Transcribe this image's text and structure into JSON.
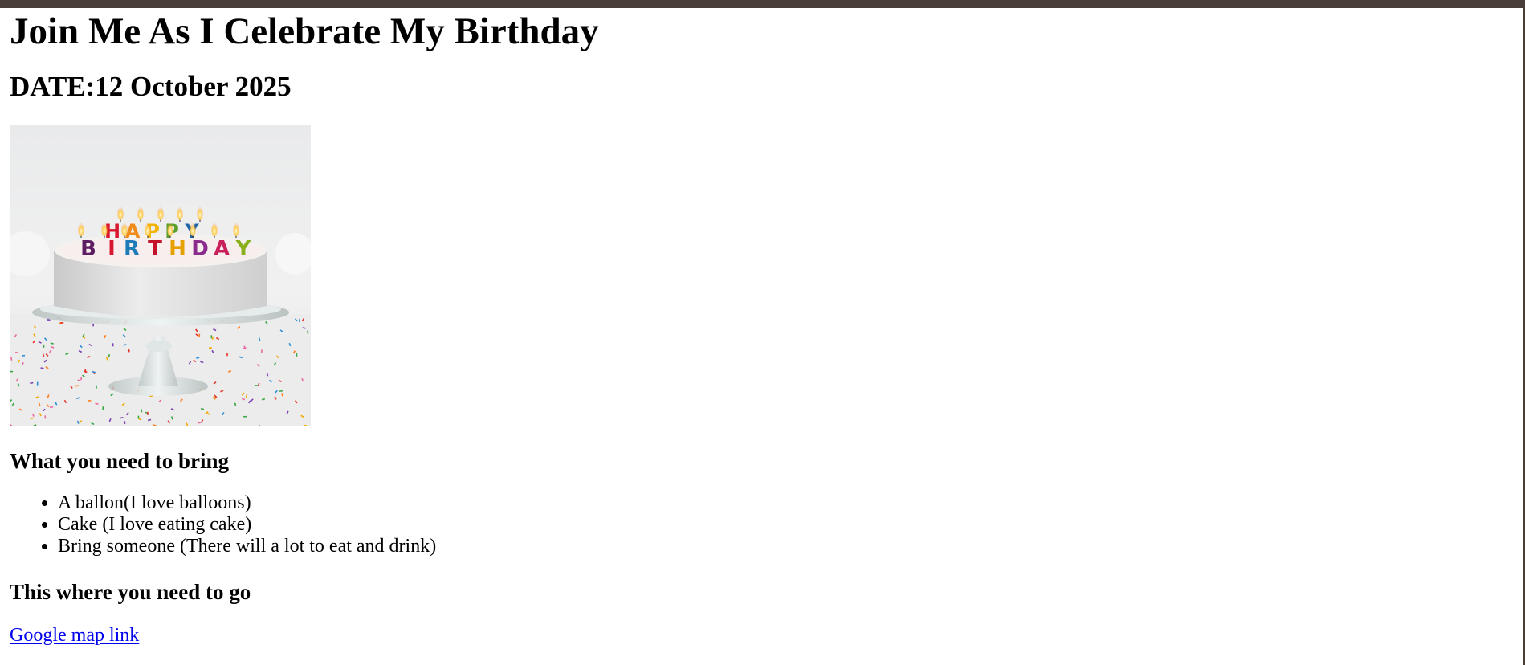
{
  "heading": "Join Me As I Celebrate My Birthday",
  "date_heading": "DATE:12 October 2025",
  "image": {
    "alt": "Birthday cake",
    "candle_letters_top": [
      "H",
      "A",
      "P",
      "P",
      "Y"
    ],
    "candle_letters_bottom": [
      "B",
      "I",
      "R",
      "T",
      "H",
      "D",
      "A",
      "Y"
    ],
    "colors_top": [
      "#d8182e",
      "#f08a18",
      "#f2b400",
      "#5aa02c",
      "#1f66a8"
    ],
    "colors_bottom": [
      "#5d1d63",
      "#d8182e",
      "#1d7bb8",
      "#c4122a",
      "#e6a000",
      "#8a2c8c",
      "#c91f5a",
      "#8ab11c"
    ]
  },
  "bring_section": {
    "heading": "What you need to bring",
    "items": [
      "A ballon(I love balloons)",
      "Cake (I love eating cake)",
      "Bring someone (There will a lot to eat and drink)"
    ]
  },
  "location_section": {
    "heading": "This where you need to go",
    "link_text": "Google map link"
  }
}
